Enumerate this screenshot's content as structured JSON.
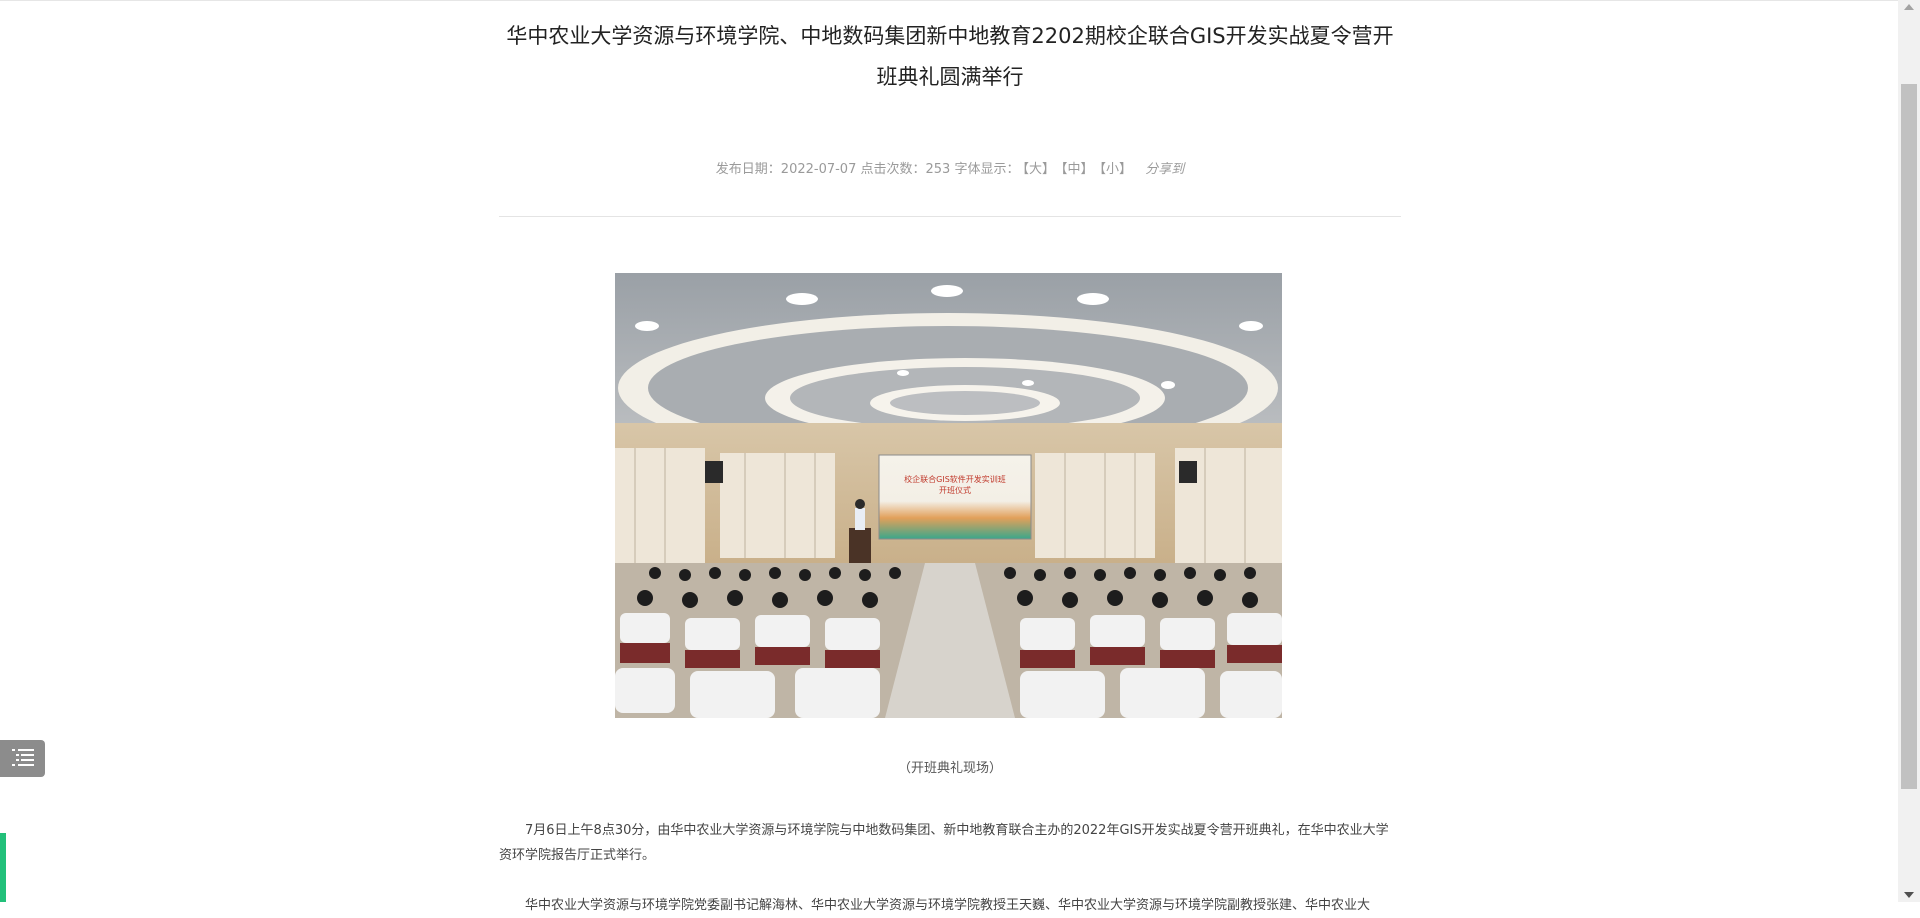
{
  "article": {
    "title": "华中农业大学资源与环境学院、中地数码集团新中地教育2202期校企联合GIS开发实战夏令营开班典礼圆满举行",
    "meta": {
      "date_label": "发布日期：",
      "date": "2022-07-07",
      "clicks_label": "点击次数：",
      "clicks": "253",
      "font_label": "字体显示：",
      "font_large": "【大】",
      "font_medium": "【中】",
      "font_small": "【小】",
      "share": "分享到"
    },
    "photo_banner": {
      "title": "校企联合GIS软件开发实训班",
      "subtitle": "开班仪式"
    },
    "caption": "（开班典礼现场）",
    "paragraphs": [
      "7月6日上午8点30分，由华中农业大学资源与环境学院与中地数码集团、新中地教育联合主办的2022年GIS开发实战夏令营开班典礼，在华中农业大学资环学院报告厅正式举行。",
      "华中农业大学资源与环境学院党委副书记解海林、华中农业大学资源与环境学院教授王天巍、华中农业大学资源与环境学院副教授张建、华中农业大"
    ]
  },
  "colors": {
    "accent_green": "#22c07a",
    "meta_gray": "#9a9a9a"
  },
  "icons": {
    "toc": "list-icon"
  }
}
